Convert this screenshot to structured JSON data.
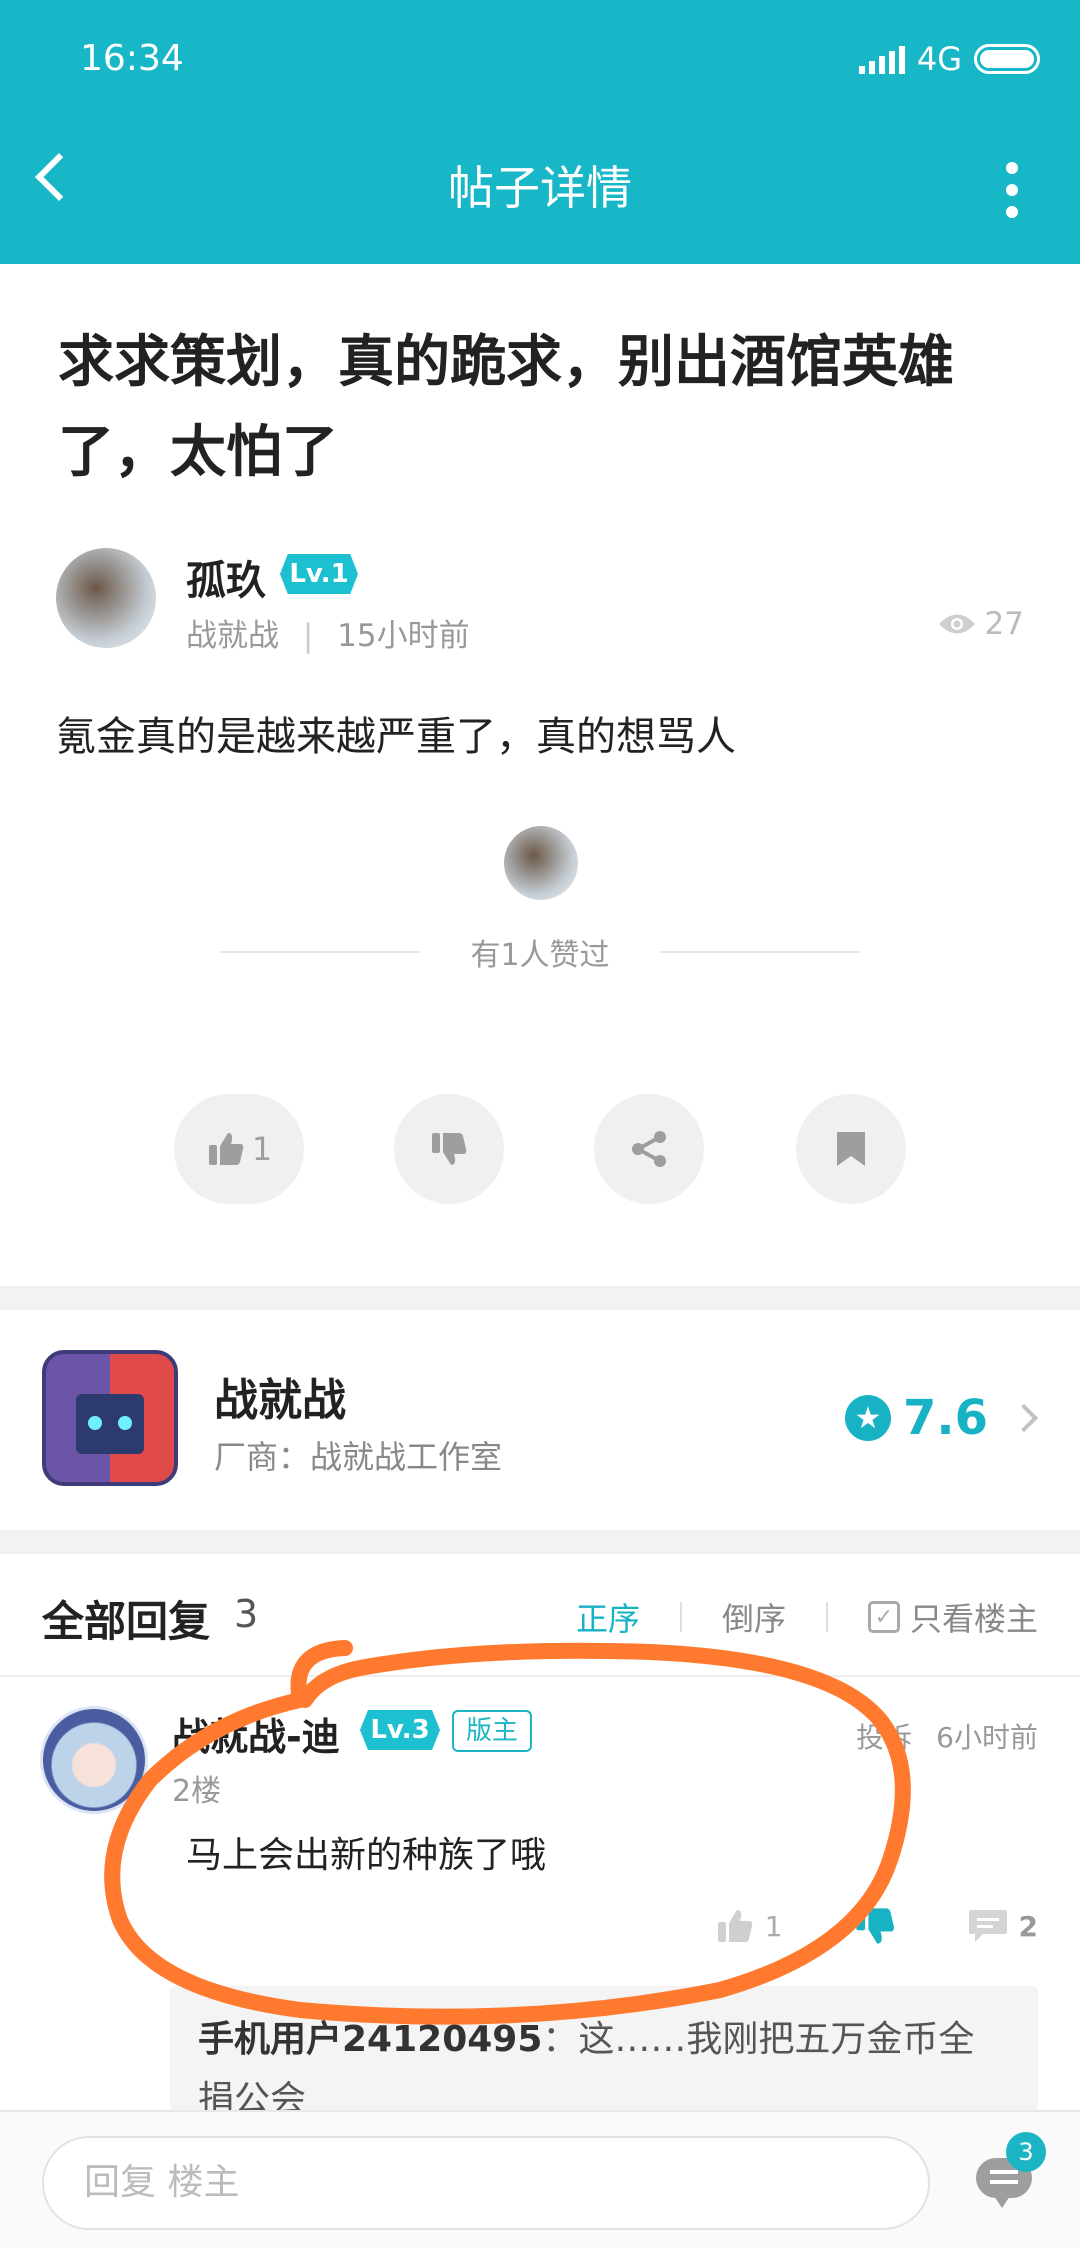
{
  "status_bar": {
    "time": "16:34",
    "network": "4G"
  },
  "header": {
    "title": "帖子详情"
  },
  "post": {
    "title": "求求策划，真的跪求，别出酒馆英雄了，太怕了",
    "author": {
      "name": "孤玖",
      "level": "Lv.1",
      "game": "战就战",
      "time": "15小时前"
    },
    "views": "27",
    "body": "氪金真的是越来越严重了，真的想骂人",
    "liked_text": "有1人赞过",
    "actions": {
      "like_count": "1"
    }
  },
  "game_card": {
    "name": "战就战",
    "vendor": "厂商：战就战工作室",
    "rating": "7.6"
  },
  "replies": {
    "title": "全部回复",
    "count": "3",
    "sort": {
      "asc": "正序",
      "desc": "倒序",
      "host_only": "只看楼主"
    },
    "items": [
      {
        "name": "战就战-迪",
        "level": "Lv.3",
        "badge": "版主",
        "report": "投诉",
        "time": "6小时前",
        "floor": "2楼",
        "content": "马上会出新的种族了哦",
        "like_count": "1",
        "comment_count": "2",
        "sub_reply": {
          "user": "手机用户24120495",
          "text": "：这……我刚把五万金币全捐公会"
        }
      }
    ]
  },
  "bottom_bar": {
    "placeholder": "回复  楼主",
    "badge": "3"
  },
  "colors": {
    "primary": "#17b7c8",
    "annotation": "#ff7a2e"
  }
}
